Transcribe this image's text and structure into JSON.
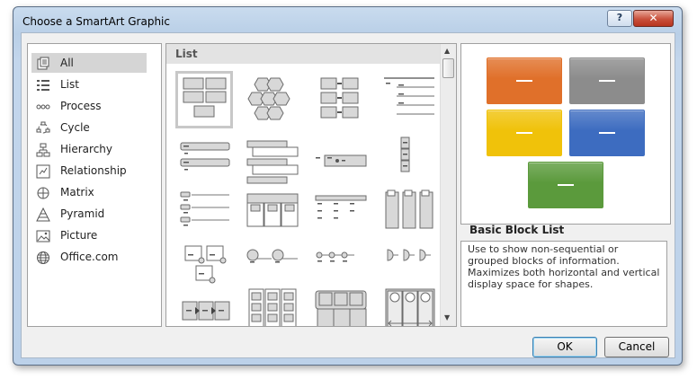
{
  "dialog": {
    "title": "Choose a SmartArt Graphic",
    "help_label": "?",
    "close_label": "✕"
  },
  "categories": [
    {
      "label": "All",
      "icon": "all-icon",
      "selected": true
    },
    {
      "label": "List",
      "icon": "list-icon"
    },
    {
      "label": "Process",
      "icon": "process-icon"
    },
    {
      "label": "Cycle",
      "icon": "cycle-icon"
    },
    {
      "label": "Hierarchy",
      "icon": "hierarchy-icon"
    },
    {
      "label": "Relationship",
      "icon": "relationship-icon"
    },
    {
      "label": "Matrix",
      "icon": "matrix-icon"
    },
    {
      "label": "Pyramid",
      "icon": "pyramid-icon"
    },
    {
      "label": "Picture",
      "icon": "picture-icon"
    },
    {
      "label": "Office.com",
      "icon": "globe-icon"
    }
  ],
  "gallery": {
    "header": "List",
    "layouts": [
      "basic-block-list",
      "stacked-hexagons",
      "alternating-flow",
      "lined-list",
      "vertical-bullet-list",
      "vertical-box-list",
      "horizontal-bullet-list",
      "stacked-list",
      "table-list",
      "grouped-list",
      "horizontal-bulleted",
      "vertical-chevron",
      "picture-caption-list",
      "horizontal-picture-list",
      "trapezoid-list",
      "bending-picture",
      "descending-block-list",
      "pie-process",
      "square-accent-list",
      "picture-accent-list"
    ]
  },
  "preview": {
    "title": "Basic Block List",
    "description": "Use to show non-sequential or grouped blocks of information. Maximizes both horizontal and vertical display space for shapes.",
    "colors": {
      "orange": "#e0702a",
      "gray": "#8c8c8c",
      "gold": "#f0c20a",
      "blue": "#3d6cc0",
      "green": "#5b9a3c"
    }
  },
  "buttons": {
    "ok_label": "OK",
    "cancel_label": "Cancel"
  }
}
